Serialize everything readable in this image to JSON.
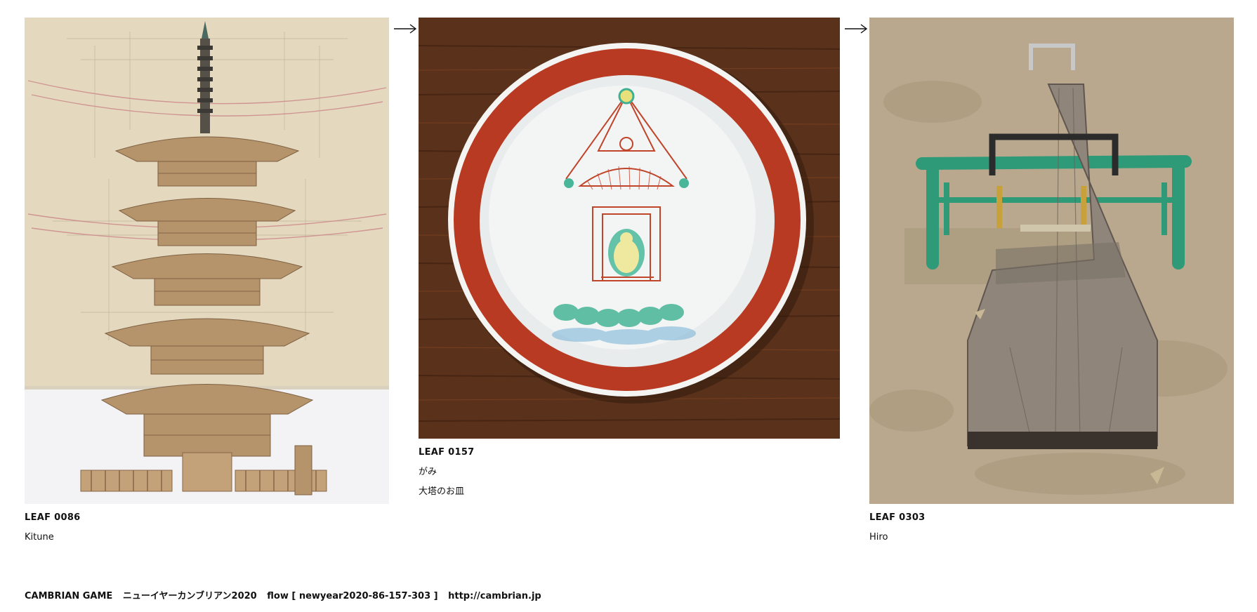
{
  "flow": {
    "leaves": [
      {
        "id": "LEAF 0086",
        "author": "Kitune",
        "title": ""
      },
      {
        "id": "LEAF 0157",
        "author": "がみ",
        "title": "大塔のお皿"
      },
      {
        "id": "LEAF 0303",
        "author": "Hiro",
        "title": ""
      }
    ],
    "arrow_glyph": "→"
  },
  "footer": {
    "game": "CAMBRIAN GAME",
    "event": "ニューイヤーカンブリアン2020",
    "flow_label": "flow [ newyear2020-86-157-303 ]",
    "url": "http://cambrian.jp"
  },
  "colors": {
    "background": "#ffffff",
    "text": "#111111",
    "plate_rim": "#b93a22",
    "wood": "#6b3b1c",
    "sand": "#b9a88d",
    "seesaw_green": "#2f9a78"
  },
  "icons": {
    "arrow": "right-arrow-icon"
  }
}
